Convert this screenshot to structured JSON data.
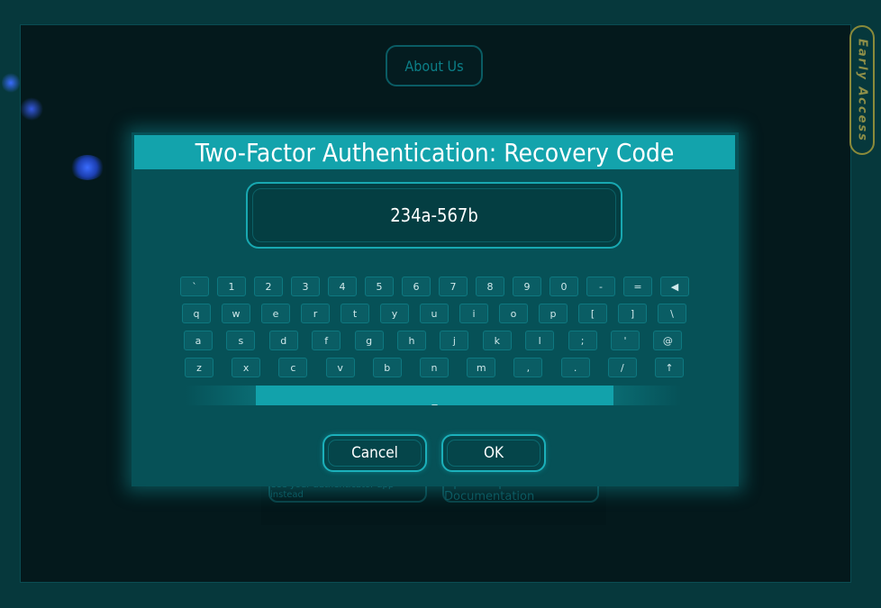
{
  "background": {
    "about_button": "About Us",
    "early_access_badge": "Early Access",
    "bottom_left_button": "Use your authenticator app instead",
    "bottom_right_button": "Open Help Documentation"
  },
  "dialog": {
    "title": "Two-Factor Authentication: Recovery Code",
    "code_value": "234a-567b",
    "keyboard": {
      "row1": [
        "`",
        "1",
        "2",
        "3",
        "4",
        "5",
        "6",
        "7",
        "8",
        "9",
        "0",
        "-",
        "=",
        "◀"
      ],
      "row2": [
        "q",
        "w",
        "e",
        "r",
        "t",
        "y",
        "u",
        "i",
        "o",
        "p",
        "[",
        "]",
        "\\"
      ],
      "row3": [
        "a",
        "s",
        "d",
        "f",
        "g",
        "h",
        "j",
        "k",
        "l",
        ";",
        "'",
        "@"
      ],
      "row4": [
        "z",
        "x",
        "c",
        "v",
        "b",
        "n",
        "m",
        ",",
        ".",
        "/",
        "↑"
      ],
      "space_label": "_"
    },
    "cancel_label": "Cancel",
    "ok_label": "OK"
  },
  "colors": {
    "accent": "#13a3ac",
    "dialog_bg": "#065157",
    "background": "#04191c",
    "early_access": "#8f8f48"
  }
}
